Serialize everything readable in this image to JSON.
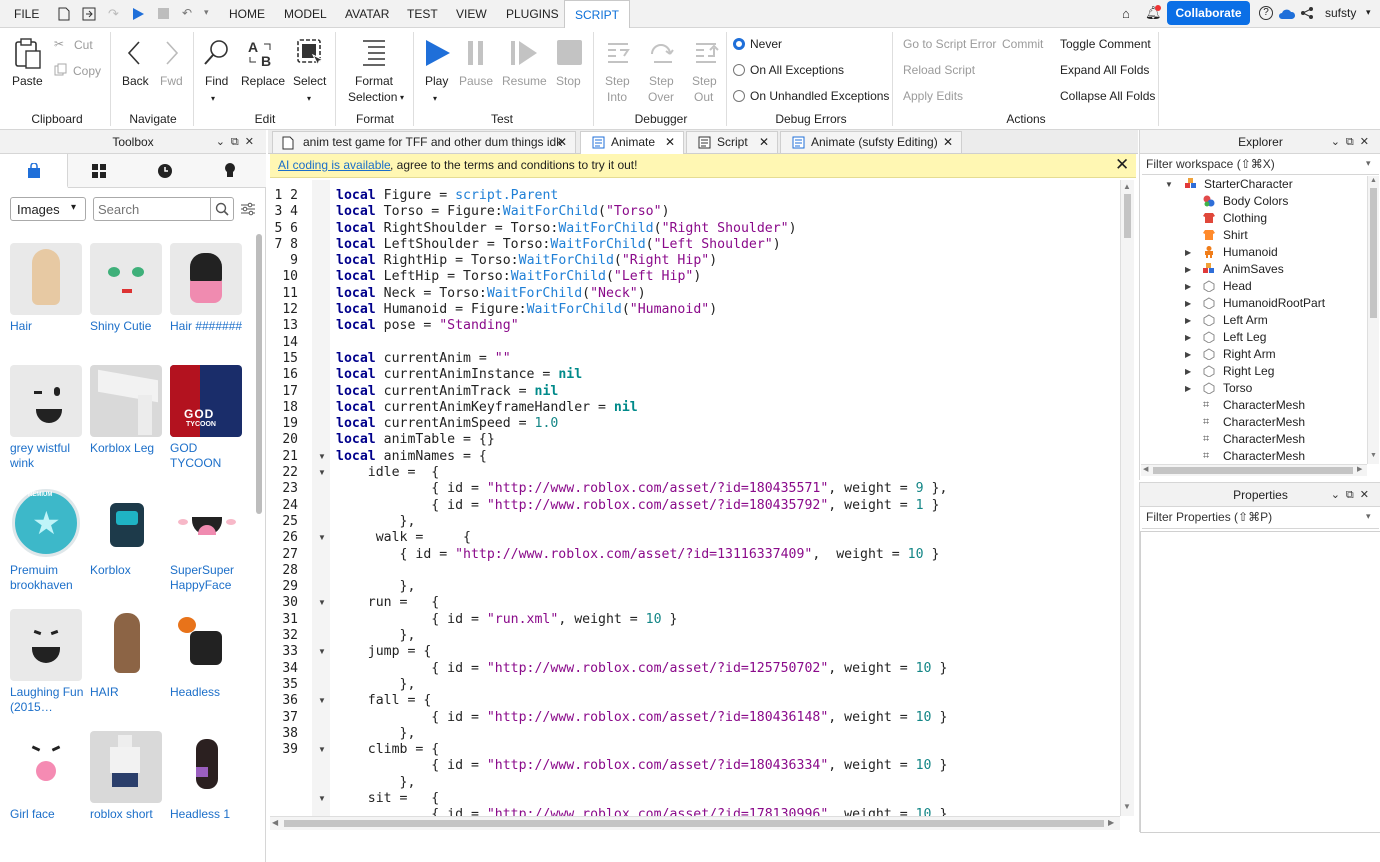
{
  "menu": {
    "file": "FILE",
    "tabs": [
      "HOME",
      "MODEL",
      "AVATAR",
      "TEST",
      "VIEW",
      "PLUGINS",
      "SCRIPT"
    ],
    "collaborate": "Collaborate",
    "username": "sufsty"
  },
  "ribbon": {
    "clipboard": {
      "paste": "Paste",
      "cut": "Cut",
      "copy": "Copy",
      "group": "Clipboard"
    },
    "navigate": {
      "back": "Back",
      "fwd": "Fwd",
      "group": "Navigate"
    },
    "edit": {
      "find": "Find",
      "replace": "Replace",
      "select": "Select",
      "group": "Edit"
    },
    "format": {
      "line1": "Format",
      "line2": "Selection",
      "group": "Format"
    },
    "test": {
      "play": "Play",
      "pause": "Pause",
      "resume": "Resume",
      "stop": "Stop",
      "group": "Test"
    },
    "debugger": {
      "step_into_1": "Step",
      "step_into_2": "Into",
      "step_over_1": "Step",
      "step_over_2": "Over",
      "step_out_1": "Step",
      "step_out_2": "Out",
      "group": "Debugger"
    },
    "debug_errors": {
      "never": "Never",
      "all": "On All Exceptions",
      "unhandled": "On Unhandled Exceptions",
      "group": "Debug Errors"
    },
    "actions": {
      "goto": "Go to Script Error",
      "commit": "Commit",
      "reload": "Reload Script",
      "apply": "Apply Edits",
      "toggle": "Toggle Comment",
      "expand": "Expand All Folds",
      "collapse": "Collapse All Folds",
      "group": "Actions"
    }
  },
  "toolbox": {
    "title": "Toolbox",
    "category": "Images",
    "search_placeholder": "Search",
    "items": [
      {
        "name": "Hair"
      },
      {
        "name": "Shiny Cutie"
      },
      {
        "name": "Hair #######"
      },
      {
        "name": "grey wistful wink"
      },
      {
        "name": "Korblox Leg"
      },
      {
        "name": "GOD TYCOON"
      },
      {
        "name": "Premuim brookhaven"
      },
      {
        "name": "Korblox"
      },
      {
        "name": "SuperSuper HappyFace"
      },
      {
        "name": "Laughing Fun (2015…"
      },
      {
        "name": "HAIR"
      },
      {
        "name": "Headless"
      },
      {
        "name": "Girl face"
      },
      {
        "name": "roblox short"
      },
      {
        "name": "Headless 1"
      }
    ],
    "god_text": "GOD",
    "tycoon_text": "TYCOON",
    "premium_text": "PREMIUM"
  },
  "editor": {
    "tabs": [
      {
        "label": "anim test game for TFF and other dum things idk"
      },
      {
        "label": "Animate"
      },
      {
        "label": "Script"
      },
      {
        "label": "Animate (sufsty Editing)"
      }
    ],
    "banner_link": "AI coding is available",
    "banner_rest": ", agree to the terms and conditions to try it out!"
  },
  "explorer": {
    "title": "Explorer",
    "filter": "Filter workspace (⇧⌘X)",
    "items": [
      "StarterCharacter",
      "Body Colors",
      "Clothing",
      "Shirt",
      "Humanoid",
      "AnimSaves",
      "Head",
      "HumanoidRootPart",
      "Left Arm",
      "Left Leg",
      "Right Arm",
      "Right Leg",
      "Torso",
      "CharacterMesh",
      "CharacterMesh",
      "CharacterMesh",
      "CharacterMesh"
    ]
  },
  "properties": {
    "title": "Properties",
    "filter": "Filter Properties (⇧⌘P)"
  },
  "colors": {
    "accent": "#1c6fc9",
    "collab": "#0b6fe6",
    "banner": "#fff7b3"
  }
}
